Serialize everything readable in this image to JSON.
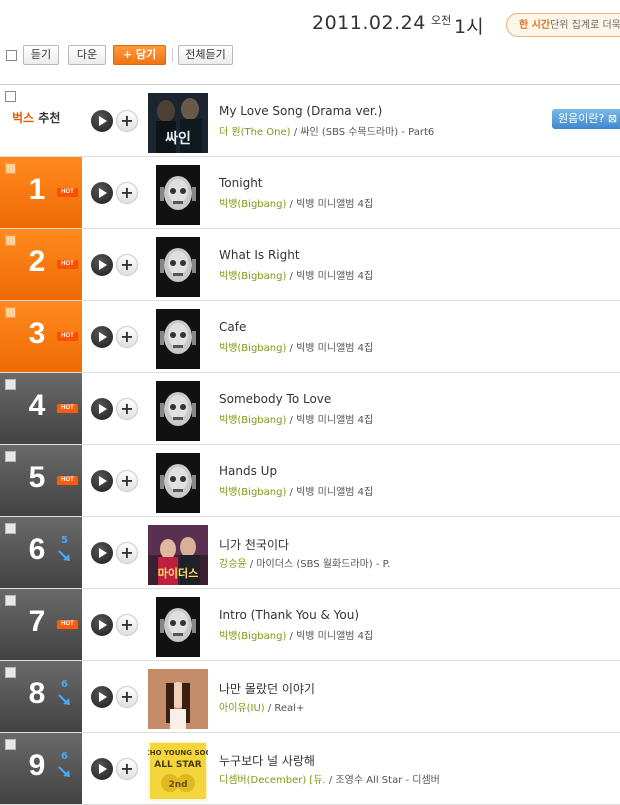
{
  "header": {
    "date": "2011.02.24",
    "ampm": "오전",
    "hour": "1시",
    "banner_bold": "한 시간",
    "banner_text": "단위 집계로 더욱 빨"
  },
  "toolbar": {
    "listen": "듣기",
    "download": "다운",
    "add": "+ 담기",
    "listen_all": "전체듣기"
  },
  "recommend": {
    "label_a": "벅스",
    "label_b": "추천",
    "title": "My Love Song (Drama ver.)",
    "artist": "더 원(The One)",
    "album": "싸인 (SBS 수목드라마) - Part6",
    "info_button": "원음이란?"
  },
  "colors": {
    "accent_orange": "#f06a05",
    "rank_gray": "#4a4a4a",
    "artist_green": "#7a9a12",
    "delta_blue": "#4aa6f5"
  },
  "rows": [
    {
      "rank": "1",
      "status": "HOT",
      "delta": "",
      "title": "Tonight",
      "artist": "빅뱅(Bigbang)",
      "album": "빅뱅 미니앨범 4집"
    },
    {
      "rank": "2",
      "status": "HOT",
      "delta": "",
      "title": "What Is Right",
      "artist": "빅뱅(Bigbang)",
      "album": "빅뱅 미니앨범 4집"
    },
    {
      "rank": "3",
      "status": "HOT",
      "delta": "",
      "title": "Cafe",
      "artist": "빅뱅(Bigbang)",
      "album": "빅뱅 미니앨범 4집"
    },
    {
      "rank": "4",
      "status": "HOT",
      "delta": "",
      "title": "Somebody To Love",
      "artist": "빅뱅(Bigbang)",
      "album": "빅뱅 미니앨범 4집"
    },
    {
      "rank": "5",
      "status": "HOT",
      "delta": "",
      "title": "Hands Up",
      "artist": "빅뱅(Bigbang)",
      "album": "빅뱅 미니앨범 4집"
    },
    {
      "rank": "6",
      "status": "",
      "delta": "5",
      "title": "니가 천국이다",
      "artist": "강승윤",
      "album": "마이더스 (SBS 월화드라마) - P."
    },
    {
      "rank": "7",
      "status": "HOT",
      "delta": "",
      "title": "Intro (Thank You & You)",
      "artist": "빅뱅(Bigbang)",
      "album": "빅뱅 미니앨범 4집"
    },
    {
      "rank": "8",
      "status": "",
      "delta": "6",
      "title": "나만 몰랐던 이야기",
      "artist": "아이유(IU)",
      "album": "Real+"
    },
    {
      "rank": "9",
      "status": "",
      "delta": "6",
      "title": "누구보다 널 사랑해",
      "artist": "디셈버(December) [듀.",
      "album": "조영수 All Star - 디셈버"
    }
  ]
}
